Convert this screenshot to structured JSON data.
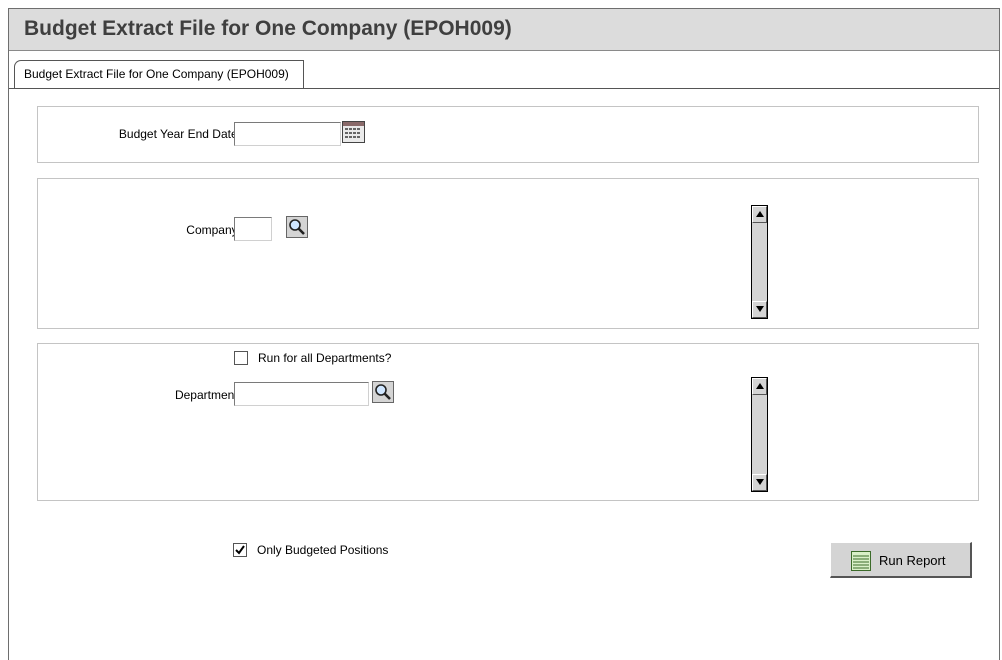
{
  "window": {
    "title": "Budget Extract File for One Company (EPOH009)"
  },
  "tabs": [
    {
      "label": "Budget Extract File for One Company (EPOH009)"
    }
  ],
  "budget": {
    "year_end_label": "Budget Year End Date:",
    "year_end_value": ""
  },
  "company": {
    "label": "Company:",
    "value": ""
  },
  "department": {
    "run_all_label": "Run for all Departments?",
    "run_all_checked": false,
    "label": "Department:",
    "value": ""
  },
  "options": {
    "only_budgeted_label": "Only Budgeted Positions",
    "only_budgeted_checked": true
  },
  "actions": {
    "run_report_label": "Run Report"
  }
}
